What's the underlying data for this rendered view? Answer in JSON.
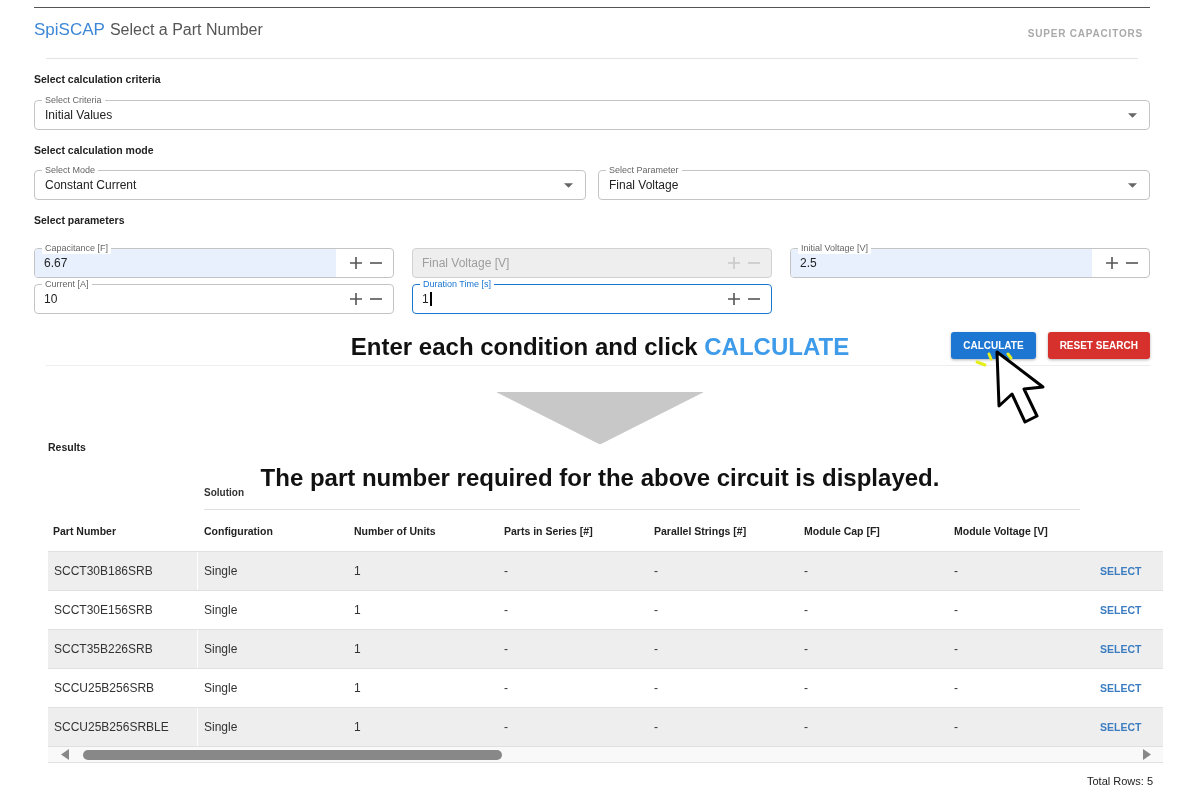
{
  "header": {
    "brand": "SpiSCAP",
    "title": "Select a Part Number",
    "category": "SUPER CAPACITORS"
  },
  "criteria": {
    "heading": "Select calculation criteria",
    "select": {
      "label": "Select Criteria",
      "value": "Initial Values"
    }
  },
  "mode": {
    "heading": "Select calculation mode",
    "selects": [
      {
        "label": "Select Mode",
        "value": "Constant Current"
      },
      {
        "label": "Select Parameter",
        "value": "Final Voltage"
      }
    ]
  },
  "parameters": {
    "heading": "Select parameters",
    "fields": [
      {
        "label": "Capacitance [F]",
        "value": "6.67",
        "disabled": false,
        "focused": false,
        "autofilled": true
      },
      {
        "placeholder": "Final Voltage [V]",
        "disabled": true,
        "focused": false,
        "autofilled": false
      },
      {
        "label": "Initial Voltage [V]",
        "value": "2.5",
        "disabled": false,
        "focused": false,
        "autofilled": true
      },
      {
        "label": "Current [A]",
        "value": "10",
        "disabled": false,
        "focused": false,
        "autofilled": false
      },
      {
        "label": "Duration Time [s]",
        "value": "1",
        "disabled": false,
        "focused": true,
        "autofilled": false
      }
    ]
  },
  "buttons": [
    {
      "label": "CALCULATE",
      "kind": "primary"
    },
    {
      "label": "RESET SEARCH",
      "kind": "danger"
    }
  ],
  "annotations": {
    "instruction": {
      "text": "Enter each condition and click",
      "highlight": "CALCULATE"
    },
    "note": "The part number required for the above circuit is displayed."
  },
  "results": {
    "heading": "Results",
    "group_header": "Solution",
    "columns": [
      "Part Number",
      "Configuration",
      "Number of Units",
      "Parts in Series [#]",
      "Parallel Strings [#]",
      "Module Cap [F]",
      "Module Voltage [V]"
    ],
    "rows": [
      {
        "cells": [
          "SCCT30B186SRB",
          "Single",
          "1",
          "-",
          "-",
          "-",
          "-"
        ],
        "action": "SELECT"
      },
      {
        "cells": [
          "SCCT30E156SRB",
          "Single",
          "1",
          "-",
          "-",
          "-",
          "-"
        ],
        "action": "SELECT"
      },
      {
        "cells": [
          "SCCT35B226SRB",
          "Single",
          "1",
          "-",
          "-",
          "-",
          "-"
        ],
        "action": "SELECT"
      },
      {
        "cells": [
          "SCCU25B256SRB",
          "Single",
          "1",
          "-",
          "-",
          "-",
          "-"
        ],
        "action": "SELECT"
      },
      {
        "cells": [
          "SCCU25B256SRBLE",
          "Single",
          "1",
          "-",
          "-",
          "-",
          "-"
        ],
        "action": "SELECT"
      }
    ],
    "total": "Total Rows: 5"
  }
}
